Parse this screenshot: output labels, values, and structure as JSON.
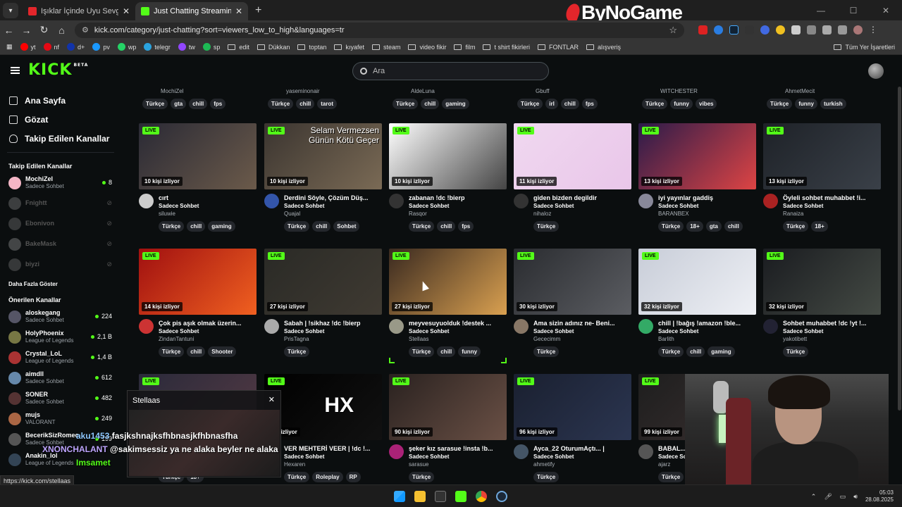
{
  "browser": {
    "tabs": [
      {
        "title": "Işıklar İçinde Uyu Sevgili Cem -",
        "favicon_color": "#e3262b"
      },
      {
        "title": "Just Chatting Streaming - Live S",
        "favicon_color": "#53fc18"
      }
    ],
    "url": "kick.com/category/just-chatting?sort=viewers_low_to_high&languages=tr",
    "brand_overlay": "ByNoGame",
    "bookmarks": [
      {
        "label": "yt",
        "color": "#ff0000"
      },
      {
        "label": "nf",
        "color": "#e50914"
      },
      {
        "label": "d+",
        "color": "#1133aa"
      },
      {
        "label": "pv",
        "color": "#1a98ff"
      },
      {
        "label": "wp",
        "color": "#25d366"
      },
      {
        "label": "telegr",
        "color": "#2aa3df"
      },
      {
        "label": "tw",
        "color": "#9146ff"
      },
      {
        "label": "sp",
        "color": "#1db954"
      },
      {
        "label": "edit",
        "folder": true
      },
      {
        "label": "Dükkan",
        "folder": true
      },
      {
        "label": "toptan",
        "folder": true
      },
      {
        "label": "kıyafet",
        "folder": true
      },
      {
        "label": "steam",
        "folder": true
      },
      {
        "label": "video fikir",
        "folder": true
      },
      {
        "label": "film",
        "folder": true
      },
      {
        "label": "t shirt fikirleri",
        "folder": true
      },
      {
        "label": "FONTLAR",
        "folder": true
      },
      {
        "label": "alışveriş",
        "folder": true
      }
    ],
    "bookmarks_right": "Tüm Yer İşaretleri",
    "status_url": "https://kick.com/stellaas"
  },
  "header": {
    "logo": "KICK",
    "logo_badge": "BETA",
    "search_placeholder": "Ara"
  },
  "sidebar": {
    "nav": [
      {
        "label": "Ana Sayfa",
        "icon": "home-icon"
      },
      {
        "label": "Gözat",
        "icon": "browse-icon"
      },
      {
        "label": "Takip Edilen Kanallar",
        "icon": "heart-icon"
      }
    ],
    "followed_heading": "Takip Edilen Kanallar",
    "followed": [
      {
        "name": "MochiZel",
        "category": "Sadece Sohbet",
        "count": "8",
        "online": true,
        "color": "#f4b6c6"
      },
      {
        "name": "Fnightt",
        "online": false,
        "color": "#888"
      },
      {
        "name": "Ebonivon",
        "online": false,
        "color": "#777"
      },
      {
        "name": "BakeMask",
        "online": false,
        "color": "#999"
      },
      {
        "name": "biyzi",
        "online": false,
        "color": "#777"
      }
    ],
    "show_more": "Daha Fazla Göster",
    "recommended_heading": "Önerilen Kanallar",
    "recommended": [
      {
        "name": "aloskegang",
        "category": "Sadece Sohbet",
        "count": "224",
        "color": "#556"
      },
      {
        "name": "HolyPhoenix",
        "category": "League of Legends",
        "count": "2,1 B",
        "color": "#774"
      },
      {
        "name": "Crystal_LoL",
        "category": "League of Legends",
        "count": "1,4 B",
        "color": "#a33"
      },
      {
        "name": "aimdll",
        "category": "Sadece Sohbet",
        "count": "612",
        "color": "#68a"
      },
      {
        "name": "SONER",
        "category": "Sadece Sohbet",
        "count": "482",
        "color": "#533"
      },
      {
        "name": "mujs",
        "category": "VALORANT",
        "count": "249",
        "color": "#a64"
      },
      {
        "name": "BecerikSizRomeo",
        "category": "Sadece Sohbet",
        "count": "199",
        "color": "#555"
      },
      {
        "name": "Anakin_lol",
        "category": "League of Legends",
        "count": "",
        "color": "#345"
      }
    ]
  },
  "main": {
    "row0": [
      {
        "channel": "MochiZel",
        "tags": [
          "Türkçe",
          "gta",
          "chill",
          "fps"
        ]
      },
      {
        "channel": "yaseminonair",
        "tags": [
          "Türkçe",
          "chill",
          "tarot"
        ]
      },
      {
        "channel": "AldeLuna",
        "tags": [
          "Türkçe",
          "chill",
          "gaming"
        ]
      },
      {
        "channel": "Gbuff",
        "tags": [
          "Türkçe",
          "irl",
          "chill",
          "fps"
        ]
      },
      {
        "channel": "WITCHESTER",
        "tags": [
          "Türkçe",
          "funny",
          "vibes"
        ]
      },
      {
        "channel": "AhmetMecit",
        "tags": [
          "Türkçe",
          "funny",
          "turkish"
        ]
      }
    ],
    "live_label": "LIVE",
    "rows": [
      [
        {
          "viewers": "10 kişi izliyor",
          "title": "cırt",
          "category": "Sadece Sohbet",
          "channel": "siluwie",
          "tags": [
            "Türkçe",
            "chill",
            "gaming"
          ],
          "thumb": [
            "#2a2a35",
            "#6b5a4a"
          ],
          "avatar": "#ccc"
        },
        {
          "viewers": "10 kişi izliyor",
          "title": "Derdini Söyle, Çözüm Düş...",
          "category": "Sadece Sohbet",
          "channel": "Quajal",
          "tags": [
            "Türkçe",
            "chill",
            "Sohbet"
          ],
          "thumb": [
            "#3b3530",
            "#7a6a55"
          ],
          "avatar": "#35a",
          "overlay": [
            "Selam Vermezsen",
            "Günün Kötü Geçer"
          ]
        },
        {
          "viewers": "10 kişi izliyor",
          "title": "zabanan !dc !bierp",
          "category": "Sadece Sohbet",
          "channel": "Rasqor",
          "tags": [
            "Türkçe",
            "chill",
            "fps"
          ],
          "thumb": [
            "#ffffff",
            "#444"
          ],
          "avatar": "#333"
        },
        {
          "viewers": "11 kişi izliyor",
          "title": "giden bizden degildir",
          "category": "Sadece Sohbet",
          "channel": "nihaloz",
          "tags": [
            "Türkçe"
          ],
          "thumb": [
            "#f0d8f0",
            "#e9c6e9"
          ],
          "avatar": "#333"
        },
        {
          "viewers": "13 kişi izliyor",
          "title": "iyi yayınlar gaddiş",
          "category": "Sadece Sohbet",
          "channel": "BARANBEX",
          "tags": [
            "Türkçe",
            "18+",
            "gta",
            "chill"
          ],
          "thumb": [
            "#2b1b4a",
            "#d44"
          ],
          "avatar": "#889"
        },
        {
          "viewers": "13 kişi izliyor",
          "title": "Öyleli sohbet muhabbet !i...",
          "category": "Sadece Sohbet",
          "channel": "Ranaiza",
          "tags": [
            "Türkçe",
            "18+"
          ],
          "thumb": [
            "#1e2228",
            "#3a4048"
          ],
          "avatar": "#a22"
        }
      ],
      [
        {
          "viewers": "14 kişi izliyor",
          "title": "Çok pis aşık olmak üzerin...",
          "category": "Sadece Sohbet",
          "channel": "ZindanTantuni",
          "tags": [
            "Türkçe",
            "chill",
            "Shooter"
          ],
          "thumb": [
            "#a01010",
            "#f06020"
          ],
          "avatar": "#c33"
        },
        {
          "viewers": "27 kişi izliyor",
          "title": "Sabah | !sikhaz !dc !bierp",
          "category": "Sadece Sohbet",
          "channel": "PrisTagna",
          "tags": [
            "Türkçe"
          ],
          "thumb": [
            "#2a2a26",
            "#3f3a32"
          ],
          "avatar": "#aaa"
        },
        {
          "viewers": "27 kişi izliyor",
          "title": "meyvesuyuolduk !destek ...",
          "category": "Sadece Sohbet",
          "channel": "Stellaas",
          "tags": [
            "Türkçe",
            "chill",
            "funny"
          ],
          "thumb": [
            "#3a2a20",
            "#d9a050"
          ],
          "avatar": "#998"
        },
        {
          "viewers": "30 kişi izliyor",
          "title": "Ama sizin adınız ne- Beni...",
          "category": "Sadece Sohbet",
          "channel": "Gececimm",
          "tags": [
            "Türkçe"
          ],
          "thumb": [
            "#2a2c30",
            "#5b5d62"
          ],
          "avatar": "#876"
        },
        {
          "viewers": "32 kişi izliyor",
          "title": "chill | !bağış !amazon !ble...",
          "category": "Sadece Sohbet",
          "channel": "Barlith",
          "tags": [
            "Türkçe",
            "chill",
            "gaming"
          ],
          "thumb": [
            "#c8cdd8",
            "#eef0f5"
          ],
          "avatar": "#3a6"
        },
        {
          "viewers": "32 kişi izliyor",
          "title": "Sohbet muhabbet !dc !yt !...",
          "category": "Sadece Sohbet",
          "channel": "yakotibett",
          "tags": [
            "Türkçe"
          ],
          "thumb": [
            "#1a1c20",
            "#444a44"
          ],
          "avatar": "#223"
        }
      ],
      [
        {
          "viewers": "",
          "title": "",
          "category": "",
          "channel": "",
          "tags": [
            "Türkçe",
            "18+"
          ],
          "thumb": [
            "#2a2a3a",
            "#553a44"
          ],
          "avatar": "#555"
        },
        {
          "viewers": "kişi izliyor",
          "title": "VER MEHTERİ VEER | !dc !...",
          "category": "Sadece Sohbet",
          "channel": "Hexaren",
          "tags": [
            "Türkçe",
            "Roleplay",
            "RP"
          ],
          "thumb": [
            "#000000",
            "#111"
          ],
          "avatar": "#333",
          "overlay": [
            "HX"
          ]
        },
        {
          "viewers": "90 kişi izliyor",
          "title": "şeker kız sarasue !insta !b...",
          "category": "Sadece Sohbet",
          "channel": "sarasue",
          "tags": [
            "Türkçe"
          ],
          "thumb": [
            "#2a2220",
            "#6a5045"
          ],
          "avatar": "#a27"
        },
        {
          "viewers": "96 kişi izliyor",
          "title": "Ayca_22 OturumAçtı... |",
          "category": "Sadece Sohbet",
          "channel": "ahmetify",
          "tags": [
            "Türkçe"
          ],
          "thumb": [
            "#1a2030",
            "#2b3550"
          ],
          "avatar": "#456"
        },
        {
          "viewers": "99 kişi izliyor",
          "title": "BABAL...",
          "category": "Sadece Sohbet",
          "channel": "ajarz",
          "tags": [
            "Türkçe"
          ],
          "thumb": [
            "#1e1e1e",
            "#3a3030"
          ],
          "avatar": "#555"
        }
      ]
    ]
  },
  "popup": {
    "channel": "Stellaas",
    "chat": [
      {
        "user": "aku1453",
        "msg": "fasjkshnajksfhbnasjkfhbnasfha",
        "color": "#8ec8ff"
      },
      {
        "user": "XNONCHALANT",
        "msg": "@sakimsessiz ya ne alaka beyler ne alaka",
        "color": "#bfa6ff"
      },
      {
        "user": "Imsamet",
        "msg": "",
        "color": "#53fc18"
      }
    ]
  },
  "taskbar": {
    "time": "05:03",
    "date": "28.08.2025"
  }
}
